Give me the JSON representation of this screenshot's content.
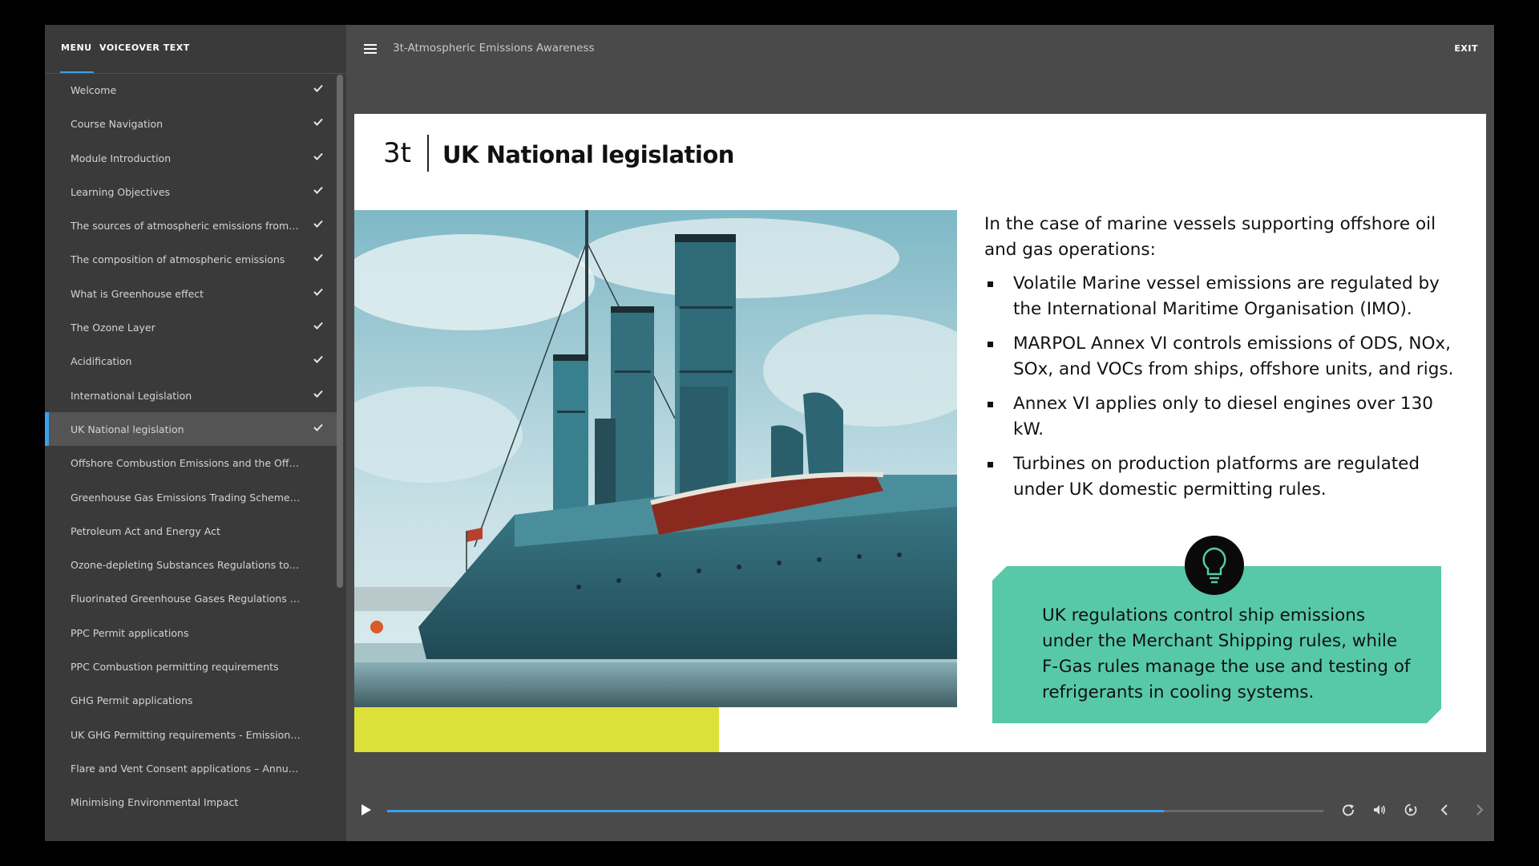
{
  "sidebar": {
    "tabs": {
      "menu": "MENU",
      "voiceover": "VOICEOVER TEXT"
    },
    "items": [
      {
        "label": "Welcome",
        "done": true
      },
      {
        "label": "Course Navigation",
        "done": true
      },
      {
        "label": "Module Introduction",
        "done": true
      },
      {
        "label": "Learning Objectives",
        "done": true
      },
      {
        "label": "The sources of atmospheric emissions from op...",
        "done": true
      },
      {
        "label": "The composition of atmospheric emissions",
        "done": true
      },
      {
        "label": "What is Greenhouse effect",
        "done": true
      },
      {
        "label": "The Ozone Layer",
        "done": true
      },
      {
        "label": "Acidification",
        "done": true
      },
      {
        "label": "International Legislation",
        "done": true
      },
      {
        "label": "UK National legislation",
        "done": true,
        "active": true
      },
      {
        "label": "Offshore Combustion Emissions and the Offsh...",
        "done": false
      },
      {
        "label": "Greenhouse Gas Emissions Trading Scheme R...",
        "done": false
      },
      {
        "label": "Petroleum Act and Energy Act",
        "done": false
      },
      {
        "label": "Ozone-depleting Substances Regulations to pr...",
        "done": false
      },
      {
        "label": "Fluorinated Greenhouse Gases Regulations to ...",
        "done": false
      },
      {
        "label": "PPC Permit applications",
        "done": false
      },
      {
        "label": "PPC Combustion permitting requirements",
        "done": false
      },
      {
        "label": "GHG Permit applications",
        "done": false
      },
      {
        "label": "UK GHG Permitting requirements - Emissions ...",
        "done": false
      },
      {
        "label": "Flare and Vent Consent applications – Annual ...",
        "done": false
      },
      {
        "label": "Minimising Environmental Impact",
        "done": false
      }
    ]
  },
  "header": {
    "course_title": "3t-Atmospheric Emissions Awareness",
    "exit_label": "EXIT"
  },
  "slide": {
    "logo_text": "3t",
    "title": "UK National legislation",
    "intro": "In the case of marine vessels supporting offshore oil and gas operations:",
    "bullets": [
      "Volatile Marine vessel emissions are regulated by the International Maritime Organisation (IMO).",
      "MARPOL Annex VI controls emissions of ODS, NOx, SOx, and VOCs from ships, offshore units, and rigs.",
      "Annex VI applies only to diesel engines over 130 kW.",
      "Turbines on production platforms are regulated under UK domestic permitting rules."
    ],
    "callout": "UK regulations control ship emissions under the Merchant Shipping rules, while F-Gas rules manage the use and testing of refrigerants in cooling systems."
  },
  "player": {
    "progress": 0.83
  },
  "colors": {
    "accent": "#3aa0e8",
    "callout": "#57c9a8",
    "highlight": "#dee03a"
  }
}
